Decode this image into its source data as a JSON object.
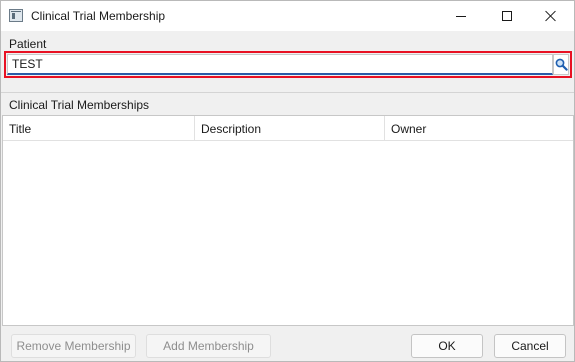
{
  "window": {
    "title": "Clinical Trial Membership",
    "icon": "app-window-icon",
    "controls": [
      "minimize-icon",
      "maximize-icon",
      "close-icon"
    ]
  },
  "patient": {
    "label": "Patient",
    "value": "TEST",
    "search_icon": "magnifier-icon",
    "highlight_color": "#e81123"
  },
  "memberships": {
    "section_title": "Clinical Trial Memberships",
    "columns": [
      "Title",
      "Description",
      "Owner"
    ],
    "rows": []
  },
  "footer": {
    "remove_label": "Remove Membership",
    "add_label": "Add Membership",
    "ok_label": "OK",
    "cancel_label": "Cancel"
  }
}
